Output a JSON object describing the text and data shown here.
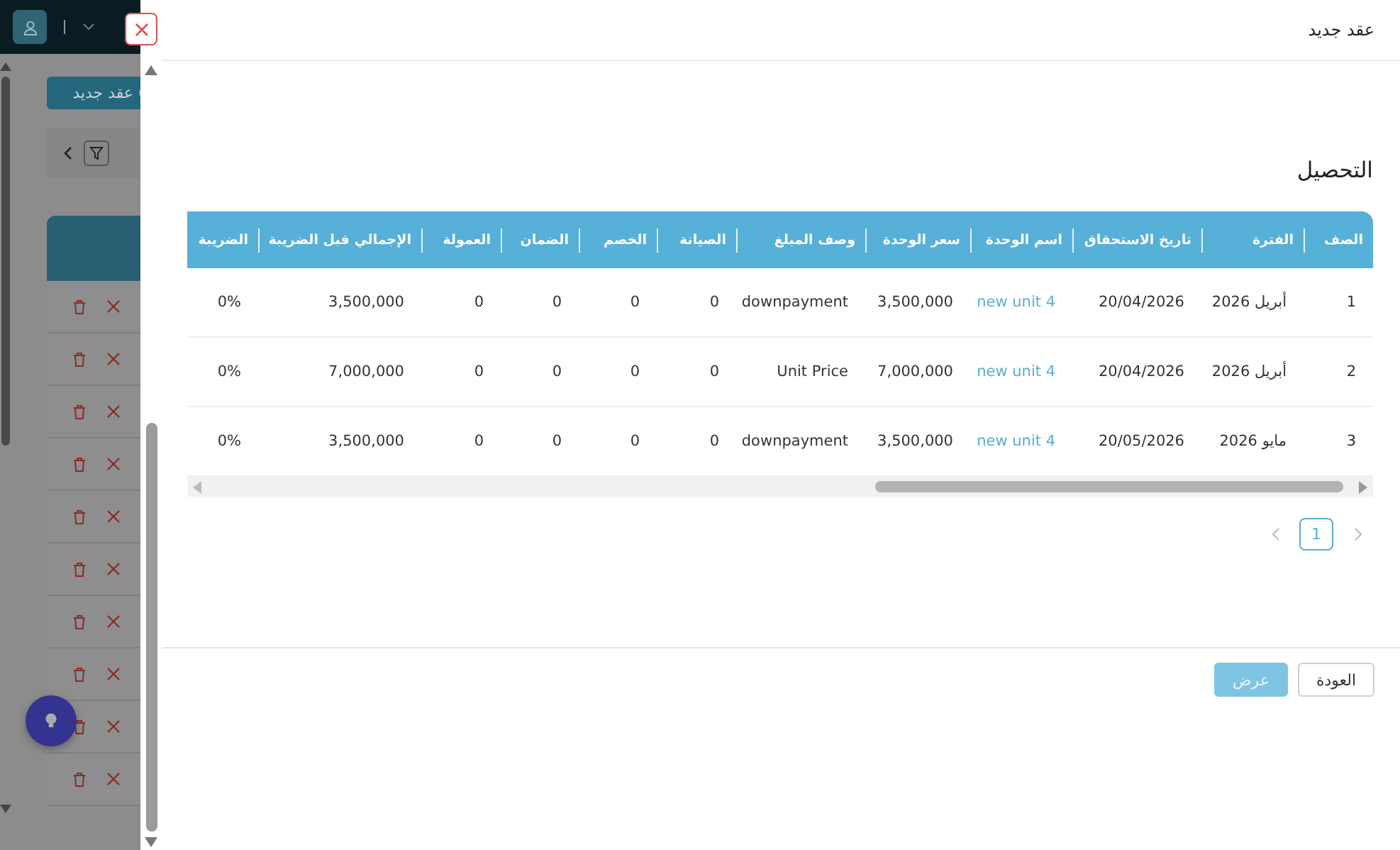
{
  "background_page": {
    "new_contract_button": "عقد جديد"
  },
  "drawer": {
    "title": "عقد جديد",
    "section_title": "التحصيل",
    "table": {
      "columns": [
        "الصف",
        "الفترة",
        "تاريخ الاستحقاق",
        "اسم الوحدة",
        "سعر الوحدة",
        "وصف المبلغ",
        "الصيانة",
        "الخصم",
        "الضمان",
        "العمولة",
        "الإجمالي قبل الضريبة",
        "الضريبة"
      ],
      "rows": [
        {
          "cells": [
            "1",
            "أبريل 2026",
            "20/04/2026",
            "new unit 4",
            "3,500,000",
            "downpayment",
            "0",
            "0",
            "0",
            "0",
            "3,500,000",
            "0%"
          ]
        },
        {
          "cells": [
            "2",
            "أبريل 2026",
            "20/04/2026",
            "new unit 4",
            "7,000,000",
            "Unit Price",
            "0",
            "0",
            "0",
            "0",
            "7,000,000",
            "0%"
          ]
        },
        {
          "cells": [
            "3",
            "مايو 2026",
            "20/05/2026",
            "new unit 4",
            "3,500,000",
            "downpayment",
            "0",
            "0",
            "0",
            "0",
            "3,500,000",
            "0%"
          ]
        }
      ]
    },
    "pagination": {
      "pages": [
        {
          "label": "1",
          "selected": true
        }
      ]
    },
    "buttons": [
      {
        "label": "العودة",
        "kind": "default",
        "disabled": false
      },
      {
        "label": "عرض",
        "kind": "primary",
        "disabled": true
      }
    ]
  }
}
